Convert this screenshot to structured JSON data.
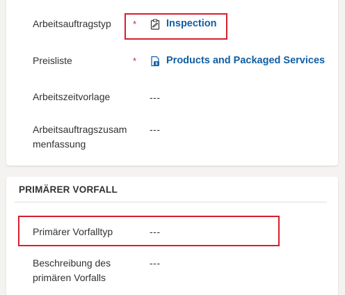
{
  "general": {
    "fields": [
      {
        "label": "Arbeitsauftragstyp",
        "required": "*",
        "value": "Inspection",
        "icon": "clipboard-icon"
      },
      {
        "label": "Preisliste",
        "required": "*",
        "value": "Products and Packaged Services",
        "icon": "price-list-icon"
      },
      {
        "label": "Arbeitszeitvorlage",
        "value": "---"
      },
      {
        "label_line1": "Arbeitsauftragszusam",
        "label_line2": "menfassung",
        "value": "---"
      }
    ]
  },
  "incident": {
    "section_title": "PRIMÄRER VORFALL",
    "fields": [
      {
        "label": "Primärer Vorfalltyp",
        "value": "---"
      },
      {
        "label_line1": "Beschreibung des",
        "label_line2": "primären Vorfalls",
        "value": "---"
      }
    ]
  },
  "colors": {
    "link": "#115ea3",
    "required": "#c4262e",
    "highlight": "#d81e2c"
  }
}
